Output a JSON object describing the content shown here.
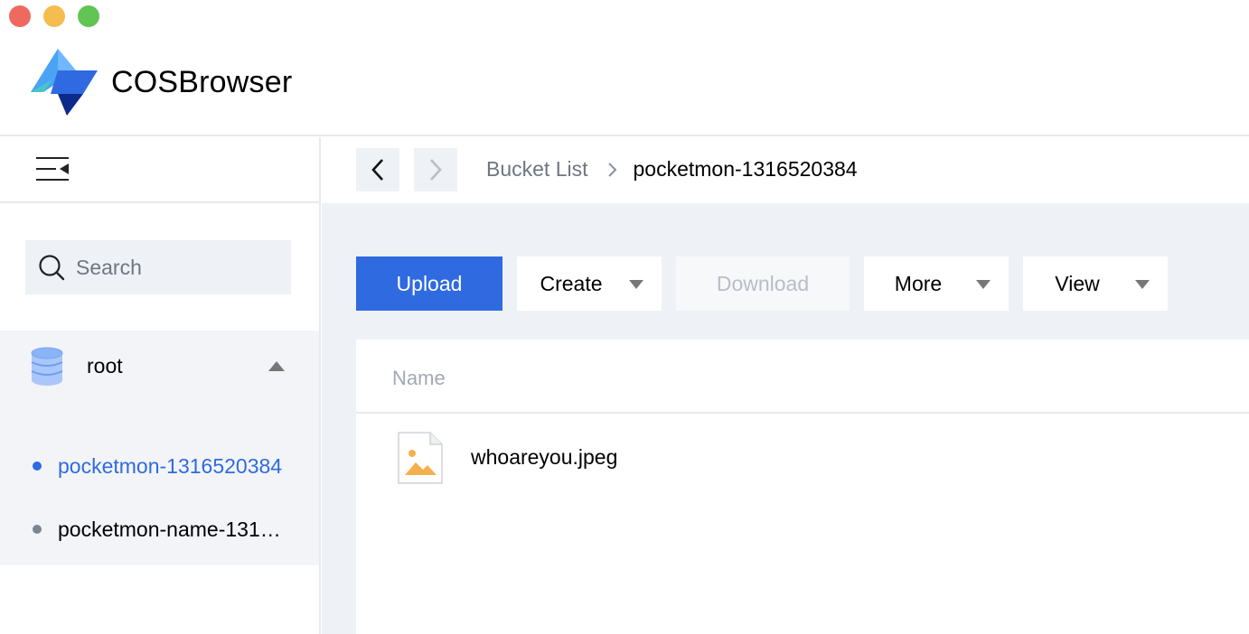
{
  "app": {
    "title": "COSBrowser"
  },
  "sidebar": {
    "search_placeholder": "Search",
    "root_label": "root",
    "buckets": [
      {
        "label": "pocketmon-1316520384",
        "active": true
      },
      {
        "label": "pocketmon-name-131…",
        "active": false
      }
    ]
  },
  "breadcrumb": {
    "root": "Bucket List",
    "current": "pocketmon-1316520384"
  },
  "toolbar": {
    "upload_label": "Upload",
    "create_label": "Create",
    "download_label": "Download",
    "more_label": "More",
    "view_label": "View"
  },
  "file_list": {
    "column_name": "Name",
    "files": [
      {
        "name": "whoareyou.jpeg",
        "icon": "image-file-icon"
      }
    ]
  },
  "colors": {
    "accent": "#2f6ae0",
    "traffic_close": "#ee6a5f",
    "traffic_min": "#f5bd4f",
    "traffic_max": "#61c454"
  }
}
